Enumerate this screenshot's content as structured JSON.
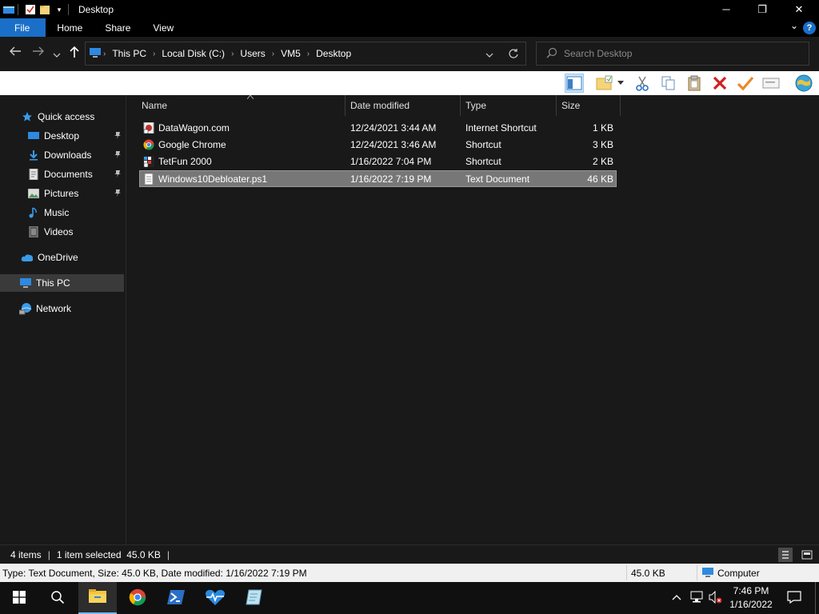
{
  "window": {
    "title": "Desktop",
    "minimize_glyph": "─",
    "maximize_glyph": "❐",
    "close_glyph": "✕"
  },
  "ribbon": {
    "tabs": [
      "File",
      "Home",
      "Share",
      "View"
    ],
    "help_glyph": "?",
    "collapse_glyph": "⌄"
  },
  "address": {
    "breadcrumbs": [
      "This PC",
      "Local Disk (C:)",
      "Users",
      "VM5",
      "Desktop"
    ],
    "separator": "›"
  },
  "search": {
    "placeholder": "Search Desktop"
  },
  "toolbar_icons": [
    "preview-pane-icon",
    "new-folder-icon",
    "dropdown-arrow-icon",
    "cut-icon",
    "copy-icon",
    "paste-icon",
    "delete-icon",
    "checkmark-icon",
    "rename-icon",
    "globe-icon"
  ],
  "nav": {
    "items": [
      {
        "label": "Quick access",
        "icon": "star-icon"
      },
      {
        "label": "Desktop",
        "icon": "desktop-icon",
        "pinned": true
      },
      {
        "label": "Downloads",
        "icon": "download-icon",
        "pinned": true
      },
      {
        "label": "Documents",
        "icon": "documents-icon",
        "pinned": true
      },
      {
        "label": "Pictures",
        "icon": "pictures-icon",
        "pinned": true
      },
      {
        "label": "Music",
        "icon": "music-icon"
      },
      {
        "label": "Videos",
        "icon": "videos-icon"
      },
      {
        "label": "OneDrive",
        "icon": "cloud-icon"
      },
      {
        "label": "This PC",
        "icon": "computer-icon",
        "selected": true
      },
      {
        "label": "Network",
        "icon": "network-icon"
      }
    ],
    "pin_glyph": "📌"
  },
  "list": {
    "columns": [
      "Name",
      "Date modified",
      "Type",
      "Size"
    ],
    "rows": [
      {
        "name": "DataWagon.com",
        "date": "12/24/2021 3:44 AM",
        "type": "Internet Shortcut",
        "size": "1 KB",
        "icon": "internet-shortcut-icon"
      },
      {
        "name": "Google Chrome",
        "date": "12/24/2021 3:46 AM",
        "type": "Shortcut",
        "size": "3 KB",
        "icon": "chrome-icon"
      },
      {
        "name": "TetFun 2000",
        "date": "1/16/2022 7:04 PM",
        "type": "Shortcut",
        "size": "2 KB",
        "icon": "app-shortcut-icon"
      },
      {
        "name": "Windows10Debloater.ps1",
        "date": "1/16/2022 7:19 PM",
        "type": "Text Document",
        "size": "46 KB",
        "icon": "text-document-icon",
        "selected": true
      }
    ]
  },
  "status": {
    "item_count": "4 items",
    "selection": "1 item selected  45.0 KB",
    "sep": "|"
  },
  "details": {
    "summary": "Type: Text Document, Size: 45.0 KB, Date modified: 1/16/2022 7:19 PM",
    "size": "45.0 KB",
    "location": "Computer"
  },
  "taskbar": {
    "clock_time": "7:46 PM",
    "clock_date": "1/16/2022"
  },
  "colors": {
    "accent": "#1a6fc9",
    "background": "#191919",
    "selection": "#777777"
  }
}
